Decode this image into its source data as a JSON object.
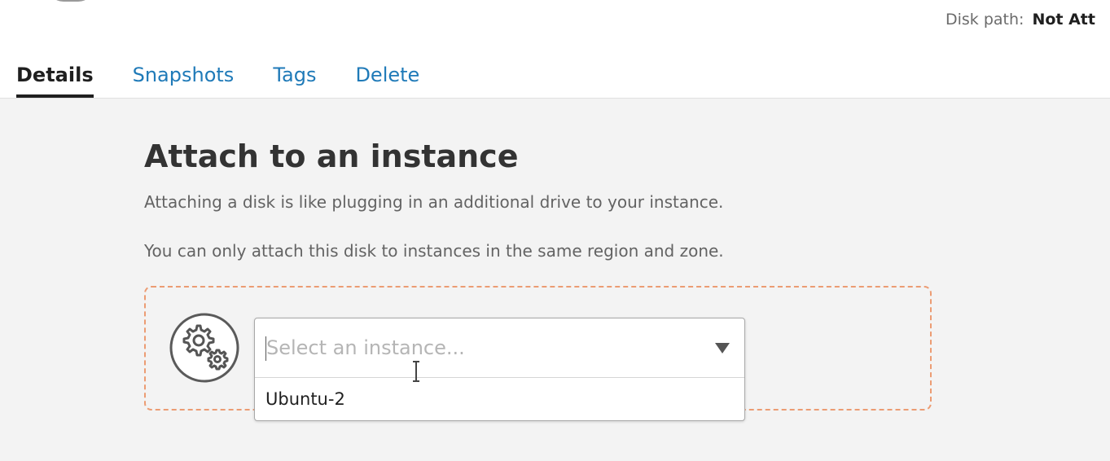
{
  "header": {
    "disk_path_label": "Disk path:",
    "disk_path_value": "Not Att"
  },
  "tabs": [
    {
      "label": "Details",
      "active": true
    },
    {
      "label": "Snapshots",
      "active": false
    },
    {
      "label": "Tags",
      "active": false
    },
    {
      "label": "Delete",
      "active": false
    }
  ],
  "attach": {
    "title": "Attach to an instance",
    "description_1": "Attaching a disk is like plugging in an additional drive to your instance.",
    "description_2": "You can only attach this disk to instances in the same region and zone.",
    "icon": "gears-icon",
    "select": {
      "placeholder": "Select an instance...",
      "options": [
        "Ubuntu-2"
      ]
    }
  },
  "colors": {
    "tab_link": "#1f7ab8",
    "dashed_border": "#ec9c73",
    "background": "#f3f3f3"
  }
}
